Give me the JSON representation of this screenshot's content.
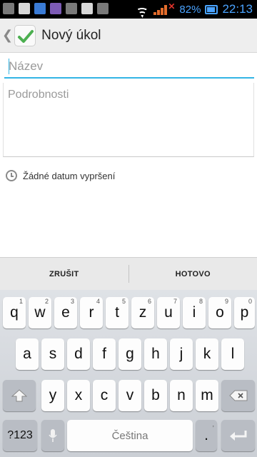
{
  "status_bar": {
    "battery_percent": "82%",
    "time": "22:13",
    "notification_icons": [
      "gallery-icon",
      "mail-icon",
      "app-icon",
      "photo-icon",
      "music-icon",
      "talk-icon",
      "image-icon"
    ]
  },
  "app_bar": {
    "title": "Nový úkol",
    "back_glyph": "❮"
  },
  "form": {
    "title_placeholder": "Název",
    "title_value": "",
    "details_placeholder": "Podrobnosti",
    "details_value": "",
    "due_date_label": "Žádné datum vypršení"
  },
  "actions": {
    "cancel_label": "ZRUŠIT",
    "done_label": "HOTOVO"
  },
  "keyboard": {
    "row1": [
      {
        "key": "q",
        "hint": "1"
      },
      {
        "key": "w",
        "hint": "2"
      },
      {
        "key": "e",
        "hint": "3"
      },
      {
        "key": "r",
        "hint": "4"
      },
      {
        "key": "t",
        "hint": "5"
      },
      {
        "key": "z",
        "hint": "6"
      },
      {
        "key": "u",
        "hint": "7"
      },
      {
        "key": "i",
        "hint": "8"
      },
      {
        "key": "o",
        "hint": "9"
      },
      {
        "key": "p",
        "hint": "0"
      }
    ],
    "row2": [
      "a",
      "s",
      "d",
      "f",
      "g",
      "h",
      "j",
      "k",
      "l"
    ],
    "row3": [
      "y",
      "x",
      "c",
      "v",
      "b",
      "n",
      "m"
    ],
    "symbols_label": "?123",
    "space_label": "Čeština",
    "period_label": ".",
    "comma_hint": ","
  },
  "colors": {
    "accent": "#33b5e5",
    "battery_clock": "#4aa3ff"
  }
}
